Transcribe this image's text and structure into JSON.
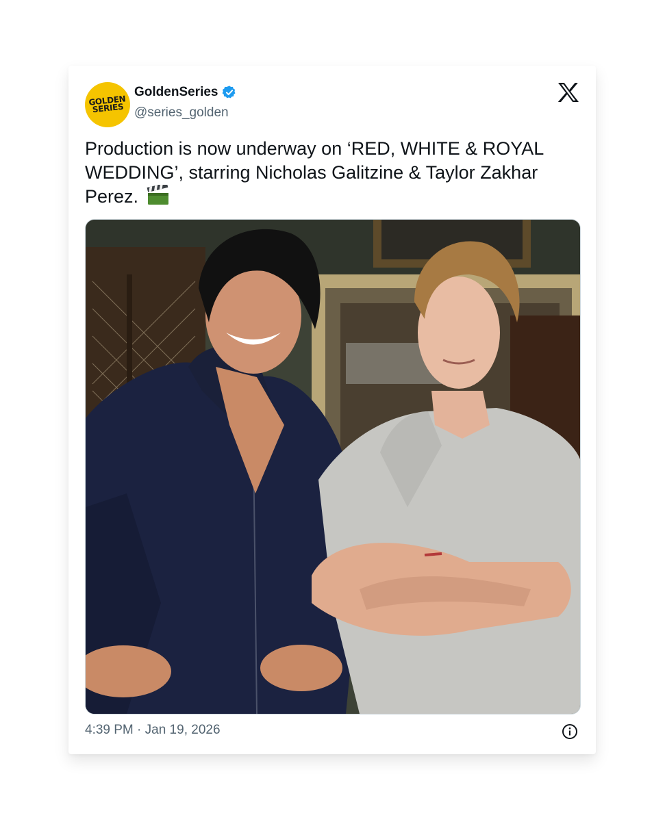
{
  "tweet": {
    "avatar_text": [
      "GOLDEN",
      "SERIES"
    ],
    "display_name": "GoldenSeries",
    "handle": "@series_golden",
    "verified": true,
    "text": "Production is now underway on ‘RED, WHITE & ROYAL WEDDING’, starring Nicholas Galitzine & Taylor Zakhar Perez.",
    "emoji_icon": "clapper-board-icon",
    "timestamp": "4:39 PM · Jan 19, 2026"
  },
  "icons": {
    "logo": "x-logo-icon",
    "verified": "verified-badge-icon",
    "info": "info-icon"
  },
  "colors": {
    "avatar_bg": "#f5c400",
    "verified_blue": "#1d9bf0",
    "text_primary": "#0f1419",
    "text_secondary": "#536471"
  }
}
